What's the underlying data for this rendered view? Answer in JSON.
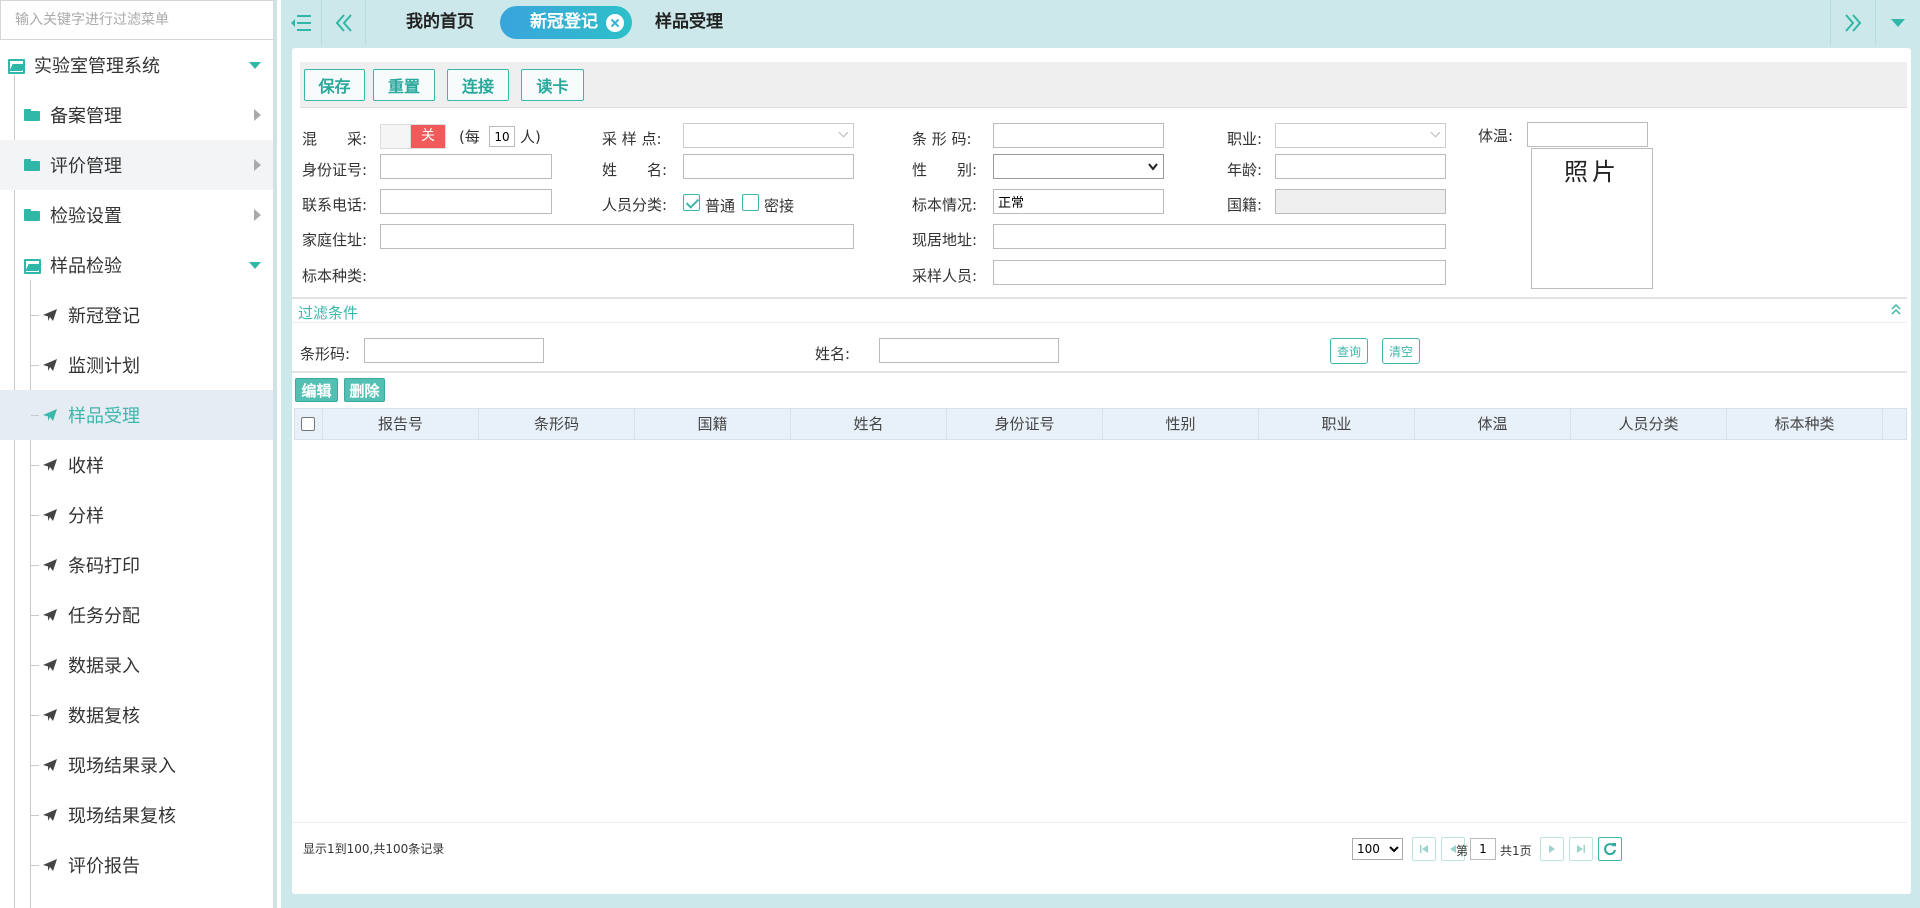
{
  "sidebar": {
    "search_placeholder": "输入关键字进行过滤菜单",
    "root": {
      "label": "实验室管理系统"
    },
    "groups": [
      {
        "label": "备案管理"
      },
      {
        "label": "评价管理"
      },
      {
        "label": "检验设置"
      },
      {
        "label": "样品检验"
      }
    ],
    "items": [
      {
        "label": "新冠登记"
      },
      {
        "label": "监测计划"
      },
      {
        "label": "样品受理"
      },
      {
        "label": "收样"
      },
      {
        "label": "分样"
      },
      {
        "label": "条码打印"
      },
      {
        "label": "任务分配"
      },
      {
        "label": "数据录入"
      },
      {
        "label": "数据复核"
      },
      {
        "label": "现场结果录入"
      },
      {
        "label": "现场结果复核"
      },
      {
        "label": "评价报告"
      }
    ]
  },
  "tabs": [
    {
      "label": "我的首页"
    },
    {
      "label": "新冠登记"
    },
    {
      "label": "样品受理"
    }
  ],
  "toolbar": {
    "save": "保存",
    "reset": "重置",
    "connect": "连接",
    "read_card": "读卡"
  },
  "form": {
    "mixed_label": "混　　采:",
    "mixed_toggle": "关",
    "per_prefix": "(每",
    "per_value": "10",
    "per_suffix": "人)",
    "sample_point_label": "采 样 点:",
    "barcode_label": "条 形 码:",
    "occupation_label": "职业:",
    "temperature_label": "体温:",
    "id_label": "身份证号:",
    "name_label": "姓　　名:",
    "gender_label": "性　　别:",
    "age_label": "年龄:",
    "phone_label": "联系电话:",
    "category_label": "人员分类:",
    "category_normal": "普通",
    "category_close": "密接",
    "specimen_status_label": "标本情况:",
    "specimen_status_value": "正常",
    "nationality_label": "国籍:",
    "home_address_label": "家庭住址:",
    "current_address_label": "现居地址:",
    "specimen_type_label": "标本种类:",
    "sampler_label": "采样人员:",
    "photo_label": "照片"
  },
  "filter": {
    "title": "过滤条件",
    "barcode_label": "条形码:",
    "name_label": "姓名:",
    "query": "查询",
    "clear": "清空"
  },
  "grid": {
    "edit": "编辑",
    "delete": "删除",
    "columns": [
      "报告号",
      "条形码",
      "国籍",
      "姓名",
      "身份证号",
      "性别",
      "职业",
      "体温",
      "人员分类",
      "标本种类"
    ]
  },
  "pager": {
    "info": "显示1到100,共100条记录",
    "page_size": "100",
    "page_prefix": "第",
    "page_value": "1",
    "page_total": "共1页"
  },
  "colors": {
    "accent": "#3cb7ab",
    "bg": "#cde8ea",
    "toggle_off": "#f05a5a",
    "tab_active_start": "#3aa4dd",
    "tab_active_end": "#2dc0c9"
  }
}
